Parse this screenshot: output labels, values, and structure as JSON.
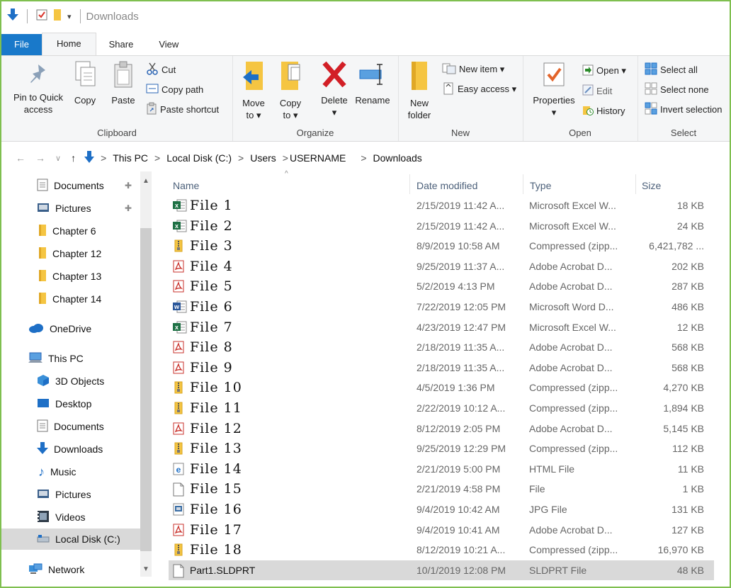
{
  "window": {
    "title": "Downloads"
  },
  "tabs": [
    {
      "label": "File"
    },
    {
      "label": "Home"
    },
    {
      "label": "Share"
    },
    {
      "label": "View"
    }
  ],
  "ribbon": {
    "clipboard": {
      "label": "Clipboard",
      "pin_line1": "Pin to Quick",
      "pin_line2": "access",
      "copy": "Copy",
      "paste": "Paste",
      "cut": "Cut",
      "copy_path": "Copy path",
      "paste_shortcut": "Paste shortcut"
    },
    "organize": {
      "label": "Organize",
      "move_to_line1": "Move",
      "move_to_line2": "to ▾",
      "copy_to_line1": "Copy",
      "copy_to_line2": "to ▾",
      "delete": "Delete",
      "delete_arrow": "▾",
      "rename": "Rename"
    },
    "new": {
      "label": "New",
      "new_folder_line1": "New",
      "new_folder_line2": "folder",
      "new_item": "New item ▾",
      "easy_access": "Easy access ▾"
    },
    "open": {
      "label": "Open",
      "properties": "Properties",
      "properties_arrow": "▾",
      "open": "Open ▾",
      "edit": "Edit",
      "history": "History"
    },
    "select": {
      "label": "Select",
      "select_all": "Select all",
      "select_none": "Select none",
      "invert_selection": "Invert selection"
    }
  },
  "address": {
    "crumbs": [
      "This PC",
      "Local Disk (C:)",
      "Users",
      "USERNAME",
      "Downloads"
    ]
  },
  "navpane": {
    "items": [
      {
        "label": "Documents",
        "icon": "documents-icon",
        "pinned": true
      },
      {
        "label": "Pictures",
        "icon": "pictures-icon",
        "pinned": true
      },
      {
        "label": "Chapter 6",
        "icon": "folder-icon"
      },
      {
        "label": "Chapter 12",
        "icon": "folder-icon"
      },
      {
        "label": "Chapter 13",
        "icon": "folder-icon"
      },
      {
        "label": "Chapter 14",
        "icon": "folder-icon"
      },
      {
        "label": "OneDrive",
        "icon": "onedrive-icon"
      },
      {
        "label": "This PC",
        "icon": "this-pc-icon"
      },
      {
        "label": "3D Objects",
        "icon": "3d-objects-icon"
      },
      {
        "label": "Desktop",
        "icon": "desktop-icon"
      },
      {
        "label": "Documents",
        "icon": "documents-icon"
      },
      {
        "label": "Downloads",
        "icon": "downloads-icon"
      },
      {
        "label": "Music",
        "icon": "music-icon"
      },
      {
        "label": "Pictures",
        "icon": "pictures-icon"
      },
      {
        "label": "Videos",
        "icon": "videos-icon"
      },
      {
        "label": "Local Disk (C:)",
        "icon": "local-disk-icon",
        "selected": true
      },
      {
        "label": "Network",
        "icon": "network-icon"
      }
    ]
  },
  "columns": {
    "name": "Name",
    "date": "Date modified",
    "type": "Type",
    "size": "Size"
  },
  "files": [
    {
      "name": "File  1",
      "date": "2/15/2019 11:42 A...",
      "type": "Microsoft Excel W...",
      "size": "18 KB",
      "icon": "excel-icon"
    },
    {
      "name": "File  2",
      "date": "2/15/2019 11:42 A...",
      "type": "Microsoft Excel W...",
      "size": "24 KB",
      "icon": "excel-icon"
    },
    {
      "name": "File  3",
      "date": "8/9/2019 10:58 AM",
      "type": "Compressed (zipp...",
      "size": "6,421,782 ...",
      "icon": "zip-icon"
    },
    {
      "name": "File  4",
      "date": "9/25/2019 11:37 A...",
      "type": "Adobe Acrobat D...",
      "size": "202 KB",
      "icon": "pdf-icon"
    },
    {
      "name": "File  5",
      "date": "5/2/2019 4:13 PM",
      "type": "Adobe Acrobat D...",
      "size": "287 KB",
      "icon": "pdf-icon"
    },
    {
      "name": "File  6",
      "date": "7/22/2019 12:05 PM",
      "type": "Microsoft Word D...",
      "size": "486 KB",
      "icon": "word-icon"
    },
    {
      "name": "File  7",
      "date": "4/23/2019 12:47 PM",
      "type": "Microsoft Excel W...",
      "size": "12 KB",
      "icon": "excel-icon"
    },
    {
      "name": "File  8",
      "date": "2/18/2019 11:35 A...",
      "type": "Adobe Acrobat D...",
      "size": "568 KB",
      "icon": "pdf-icon"
    },
    {
      "name": "File  9",
      "date": "2/18/2019 11:35 A...",
      "type": "Adobe Acrobat D...",
      "size": "568 KB",
      "icon": "pdf-icon"
    },
    {
      "name": "File  10",
      "date": "4/5/2019 1:36 PM",
      "type": "Compressed (zipp...",
      "size": "4,270 KB",
      "icon": "zip-icon"
    },
    {
      "name": "File  11",
      "date": "2/22/2019 10:12 A...",
      "type": "Compressed (zipp...",
      "size": "1,894 KB",
      "icon": "zip-icon"
    },
    {
      "name": "File  12",
      "date": "8/12/2019 2:05 PM",
      "type": "Adobe Acrobat D...",
      "size": "5,145 KB",
      "icon": "pdf-icon"
    },
    {
      "name": "File  13",
      "date": "9/25/2019 12:29 PM",
      "type": "Compressed (zipp...",
      "size": "112 KB",
      "icon": "zip-icon"
    },
    {
      "name": "File  14",
      "date": "2/21/2019 5:00 PM",
      "type": "HTML File",
      "size": "11 KB",
      "icon": "html-icon"
    },
    {
      "name": "File  15",
      "date": "2/21/2019 4:58 PM",
      "type": "File",
      "size": "1 KB",
      "icon": "blank-file-icon"
    },
    {
      "name": "File  16",
      "date": "9/4/2019 10:42 AM",
      "type": "JPG File",
      "size": "131 KB",
      "icon": "jpg-icon"
    },
    {
      "name": "File  17",
      "date": "9/4/2019 10:41 AM",
      "type": "Adobe Acrobat D...",
      "size": "127 KB",
      "icon": "pdf-icon"
    },
    {
      "name": "File  18",
      "date": "8/12/2019 10:21 A...",
      "type": "Compressed (zipp...",
      "size": "16,970 KB",
      "icon": "zip-icon"
    },
    {
      "name": "Part1.SLDPRT",
      "date": "10/1/2019 12:08 PM",
      "type": "SLDPRT File",
      "size": "48 KB",
      "icon": "blank-file-icon",
      "selected": true
    }
  ],
  "colors": {
    "accent": "#1979ca",
    "frame": "#7fbf4f",
    "folder": "#f5c542",
    "selection": "#d9d9d9"
  }
}
